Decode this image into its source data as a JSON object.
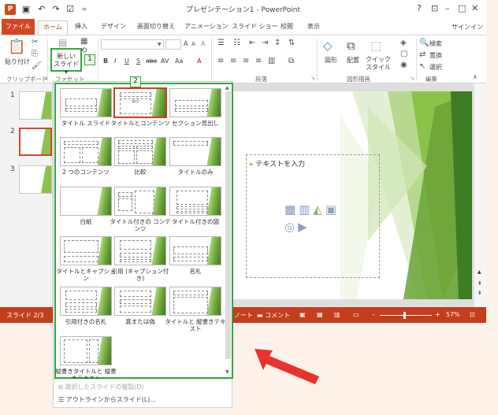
{
  "window": {
    "title": "プレゼンテーション1 - PowerPoint",
    "help": "?",
    "ribbon_display": "⊡",
    "minimize": "–",
    "maximize": "□",
    "close": "✕",
    "signin": "サインイン",
    "quick_access": {
      "save": "▣",
      "undo": "↶",
      "redo": "↷",
      "start": "☑",
      "customize": "="
    },
    "logo": "P"
  },
  "tabs": [
    {
      "label": "ファイル"
    },
    {
      "label": "ホーム"
    },
    {
      "label": "挿入"
    },
    {
      "label": "デザイン"
    },
    {
      "label": "画面切り替え"
    },
    {
      "label": "アニメーション"
    },
    {
      "label": "スライド ショー"
    },
    {
      "label": "校閲"
    },
    {
      "label": "表示"
    }
  ],
  "ribbon": {
    "paste_label": "貼り付け",
    "new_slide_label_1": "新しい",
    "new_slide_label_2": "スライド ▾",
    "callout_1": "1",
    "font_buttons": [
      "B",
      "I",
      "U",
      "S",
      "abc",
      "AV",
      "Aa",
      "A"
    ],
    "font_size_buttons": [
      "A",
      "A",
      "A"
    ],
    "shape_label": "図形",
    "arrange_label": "配置",
    "quick_style_label": "クイック スタイル",
    "find_label": "検索",
    "replace_label": "置換",
    "select_label": "選択",
    "groups": {
      "clipboard": "クリップボード",
      "slides": "ファセット",
      "paragraph": "段落",
      "drawing": "図形描画",
      "editing": "編集"
    }
  },
  "thumbnails": [
    {
      "num": "1"
    },
    {
      "num": "2"
    },
    {
      "num": "3"
    }
  ],
  "slide": {
    "bullet_text": "テキストを入力"
  },
  "status": {
    "slide_indicator": "スライド 2/3",
    "notes": "ノート",
    "comments": "コメント",
    "zoom": "57%"
  },
  "gallery": {
    "callout_2": "2",
    "layouts": [
      {
        "label": "タイトル スライド"
      },
      {
        "label": "タイトルとコンテンツ"
      },
      {
        "label": "セクション見出し"
      },
      {
        "label": "2 つのコンテンツ"
      },
      {
        "label": "比較"
      },
      {
        "label": "タイトルのみ"
      },
      {
        "label": "白紙"
      },
      {
        "label": "タイトル付きの コンテンツ"
      },
      {
        "label": "タイトル付きの図"
      },
      {
        "label": "タイトルとキャプション"
      },
      {
        "label": "引用 (キャプション付 き)"
      },
      {
        "label": "名札"
      },
      {
        "label": "引用付きの名札"
      },
      {
        "label": "真または偽"
      },
      {
        "label": "タイトルと 縦書きテキスト"
      },
      {
        "label": "縦書きタイトルと 縦書きテキスト"
      }
    ],
    "menu_items": [
      {
        "label": "選択したスライドの複製(D)"
      },
      {
        "label": "アウトラインからスライド(L)..."
      }
    ]
  },
  "colors": {
    "accent": "#d24726",
    "status_bar": "#c43e1c",
    "callout_green": "#2eaa3c",
    "selection_red": "#d33a2c"
  }
}
